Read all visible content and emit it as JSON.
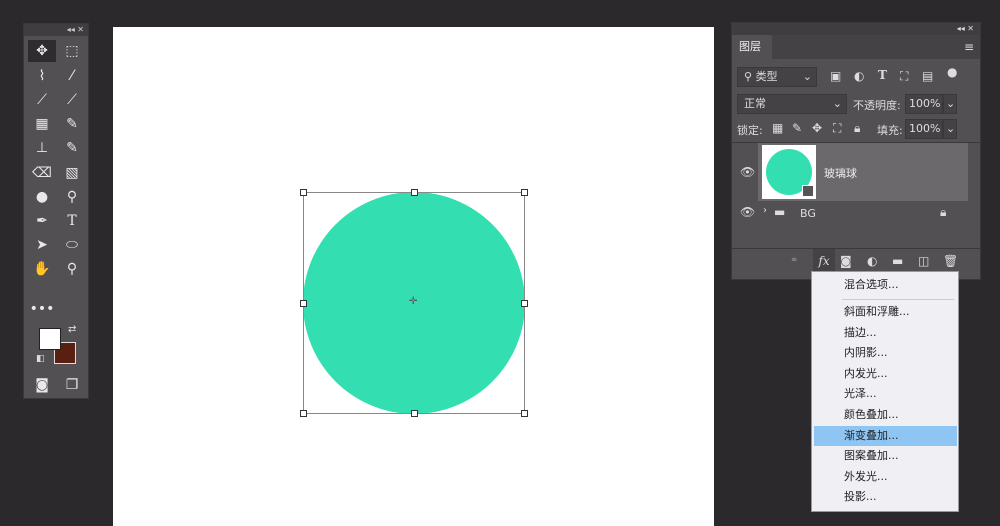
{
  "toolbar": {
    "collapse": "◂◂ ✕",
    "tools": [
      "move",
      "marquee",
      "lasso",
      "magic-wand",
      "crop",
      "eyedropper",
      "healing",
      "brush",
      "stamp",
      "history-brush",
      "eraser",
      "gradient",
      "blur",
      "dodge",
      "pen",
      "type",
      "path-select",
      "ellipse",
      "hand",
      "zoom",
      "more"
    ],
    "foreground": "#ffffff",
    "background": "#5a1f10"
  },
  "canvas": {
    "shape_color": "#33dfb0"
  },
  "layers": {
    "tab": "图层",
    "filter": "类型",
    "blend": "正常",
    "opacity_label": "不透明度:",
    "opacity": "100%",
    "lock_label": "锁定:",
    "fill_label": "填充:",
    "fill": "100%",
    "items": [
      {
        "name": "玻璃球",
        "selected": true
      },
      {
        "name": "BG",
        "type": "group",
        "locked": true
      }
    ]
  },
  "fx_menu": {
    "items": [
      "混合选项...",
      "斜面和浮雕...",
      "描边...",
      "内阴影...",
      "内发光...",
      "光泽...",
      "颜色叠加...",
      "渐变叠加...",
      "图案叠加...",
      "外发光...",
      "投影..."
    ],
    "highlighted": "渐变叠加..."
  }
}
